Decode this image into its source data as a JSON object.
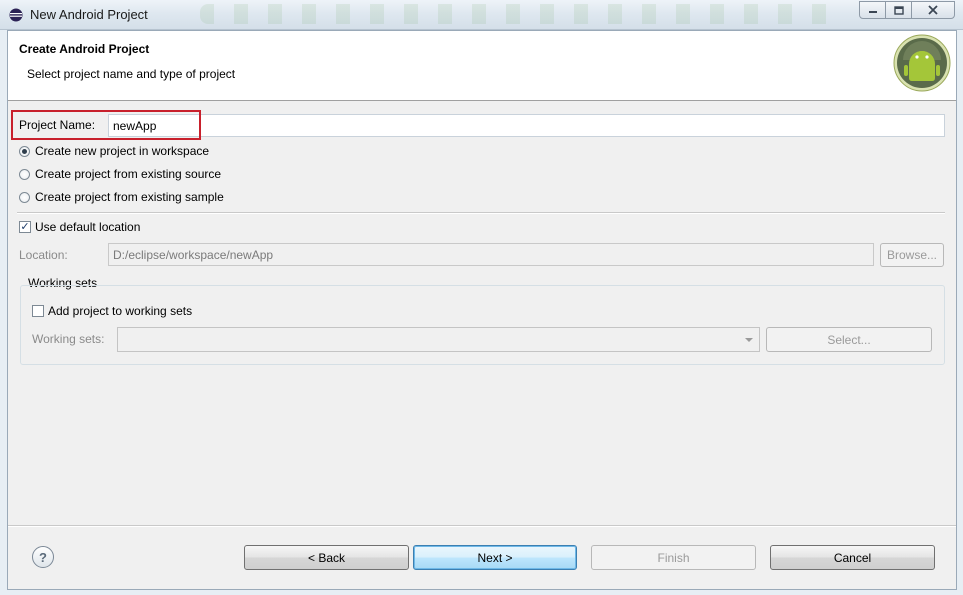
{
  "window": {
    "title": "New Android Project"
  },
  "header": {
    "title": "Create Android Project",
    "subtitle": "Select project name and type of project"
  },
  "form": {
    "project_name_label": "Project Name:",
    "project_name_value": "newApp",
    "radio_options": [
      {
        "label": "Create new project in workspace",
        "selected": true
      },
      {
        "label": "Create project from existing source",
        "selected": false
      },
      {
        "label": "Create project from existing sample",
        "selected": false
      }
    ],
    "use_default_location_label": "Use default location",
    "use_default_location_checked": true,
    "location_label": "Location:",
    "location_value": "D:/eclipse/workspace/newApp",
    "browse_label": "Browse..."
  },
  "working_sets": {
    "group_label": "Working sets",
    "add_to_working_sets_label": "Add project to working sets",
    "add_to_working_sets_checked": false,
    "working_sets_label": "Working sets:",
    "working_sets_value": "",
    "select_label": "Select..."
  },
  "footer": {
    "help_icon": "?",
    "back_label": "< Back",
    "next_label": "Next >",
    "finish_label": "Finish",
    "cancel_label": "Cancel"
  },
  "colors": {
    "highlight_box": "#c8202c",
    "primary_button": "#bee6fd",
    "android_green": "#8fbe2e"
  }
}
